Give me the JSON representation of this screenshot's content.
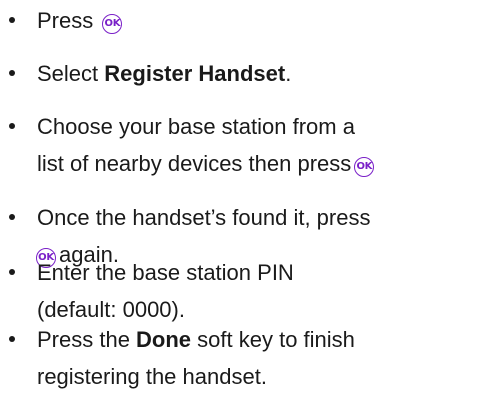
{
  "steps": [
    {
      "before": "Press",
      "icon": "ok-icon",
      "ok_label": "OK"
    },
    {
      "before": "Select ",
      "bold": "Register Handset",
      "after": "."
    },
    {
      "line1": "Choose your base station from a",
      "line2": "list of nearby devices then press",
      "icon": "ok-icon",
      "ok_label": "OK"
    },
    {
      "line1": "Once the handset’s found it, press",
      "icon": "ok-icon",
      "ok_label": "OK",
      "line2_after": "again."
    },
    {
      "line1": "Enter the base station PIN",
      "line2": "(default: 0000)."
    },
    {
      "before": "Press the ",
      "bold": "Done",
      "after": " soft key to finish",
      "line2": "registering the handset."
    }
  ],
  "colors": {
    "accent": "#7a20c8",
    "text": "#1a1a1a"
  }
}
